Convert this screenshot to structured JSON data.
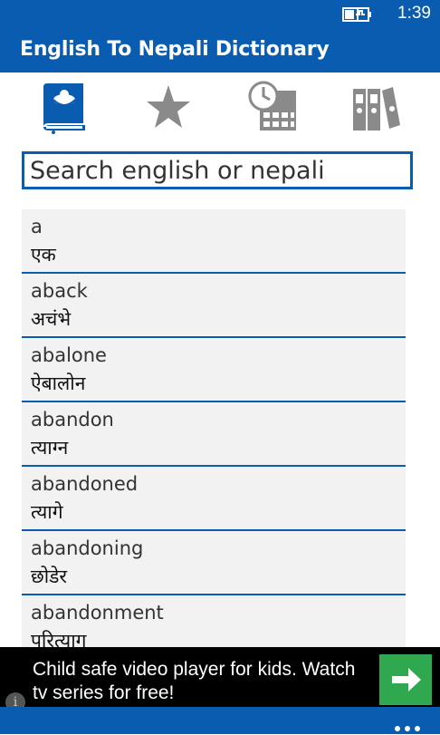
{
  "status_bar": {
    "time": "1:39",
    "battery_icon": "battery-charging-icon"
  },
  "app": {
    "title": "English To Nepali Dictionary",
    "accent_color": "#0a5cb0"
  },
  "tabs": [
    {
      "icon": "dictionary-book-icon",
      "active": true
    },
    {
      "icon": "star-favorites-icon",
      "active": false
    },
    {
      "icon": "history-clock-icon",
      "active": false
    },
    {
      "icon": "binders-icon",
      "active": false
    }
  ],
  "search": {
    "placeholder": "Search english or nepali",
    "value": ""
  },
  "words": [
    {
      "english": "a",
      "nepali": "एक"
    },
    {
      "english": "aback",
      "nepali": "अचंभे"
    },
    {
      "english": "abalone",
      "nepali": "ऐबालोन"
    },
    {
      "english": "abandon",
      "nepali": "त्याग्न"
    },
    {
      "english": "abandoned",
      "nepali": "त्यागे"
    },
    {
      "english": "abandoning",
      "nepali": "छोडेर"
    },
    {
      "english": "abandonment",
      "nepali": "परित्याग"
    }
  ],
  "ad": {
    "text": "Child safe video player for kids. Watch tv series for free!",
    "button_icon": "arrow-right-icon",
    "info_icon": "info-icon",
    "info_glyph": "i"
  },
  "app_bar": {
    "more_icon": "more-ellipsis-icon"
  }
}
